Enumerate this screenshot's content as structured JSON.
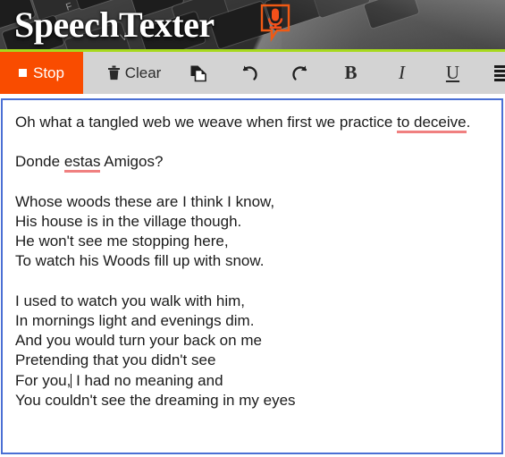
{
  "app": {
    "name": "SpeechTexter",
    "logo_text": "SpeechTexter",
    "logo_icon": "microphone-speech-bubble-icon",
    "accent_orange": "#f94c00",
    "accent_green": "#a7d91e",
    "editor_border_blue": "#4a6fd4",
    "toolbar_bg": "#d3d3d3",
    "spellcheck_underline_color": "#f08080"
  },
  "toolbar": {
    "stop": {
      "label": "Stop",
      "icon": "stop-square-icon",
      "state": "recording"
    },
    "clear": {
      "label": "Clear",
      "icon": "trash-icon"
    },
    "buttons": [
      {
        "name": "copy",
        "icon": "copy-pages-icon",
        "label": ""
      },
      {
        "name": "undo",
        "icon": "undo-arrow-icon",
        "label": "↺"
      },
      {
        "name": "redo",
        "icon": "redo-arrow-icon",
        "label": "↻"
      },
      {
        "name": "bold",
        "icon": "bold-icon",
        "label": "B"
      },
      {
        "name": "italic",
        "icon": "italic-icon",
        "label": "I"
      },
      {
        "name": "underline",
        "icon": "underline-icon",
        "label": "U"
      },
      {
        "name": "align-left",
        "icon": "align-left-icon",
        "label": ""
      },
      {
        "name": "align-center",
        "icon": "align-center-icon",
        "label": ""
      },
      {
        "name": "align-right",
        "icon": "align-right-icon",
        "label": ""
      },
      {
        "name": "justify",
        "icon": "align-justify-icon",
        "label": ""
      }
    ]
  },
  "editor": {
    "focused": true,
    "lines": [
      {
        "id": "l1",
        "type": "text",
        "before": "Oh what a tangled web we weave when first we practice ",
        "misspelled": "to deceive",
        "after": "."
      },
      {
        "id": "l2",
        "type": "blank",
        "text": ""
      },
      {
        "id": "l3",
        "type": "text",
        "before": "Donde ",
        "misspelled": "estas",
        "after": " Amigos?"
      },
      {
        "id": "l4",
        "type": "blank",
        "text": ""
      },
      {
        "id": "l5",
        "type": "plain",
        "text": "Whose woods these are I think I know,"
      },
      {
        "id": "l6",
        "type": "plain",
        "text": "His house is in the village though."
      },
      {
        "id": "l7",
        "type": "plain",
        "text": "He won't see me stopping here,"
      },
      {
        "id": "l8",
        "type": "plain",
        "text": "To watch his Woods fill up with snow."
      },
      {
        "id": "l9",
        "type": "blank",
        "text": ""
      },
      {
        "id": "l10",
        "type": "plain",
        "text": "I used to watch you walk with him,"
      },
      {
        "id": "l11",
        "type": "plain",
        "text": "In mornings light and evenings dim."
      },
      {
        "id": "l12",
        "type": "plain",
        "text": "And you would turn your back on me"
      },
      {
        "id": "l13",
        "type": "plain",
        "text": "Pretending that you didn't see"
      },
      {
        "id": "l14",
        "type": "caret",
        "before": "For you,",
        "after": " I had no meaning and"
      },
      {
        "id": "l15",
        "type": "plain",
        "text": "You couldn't see the dreaming in my eyes"
      }
    ]
  }
}
